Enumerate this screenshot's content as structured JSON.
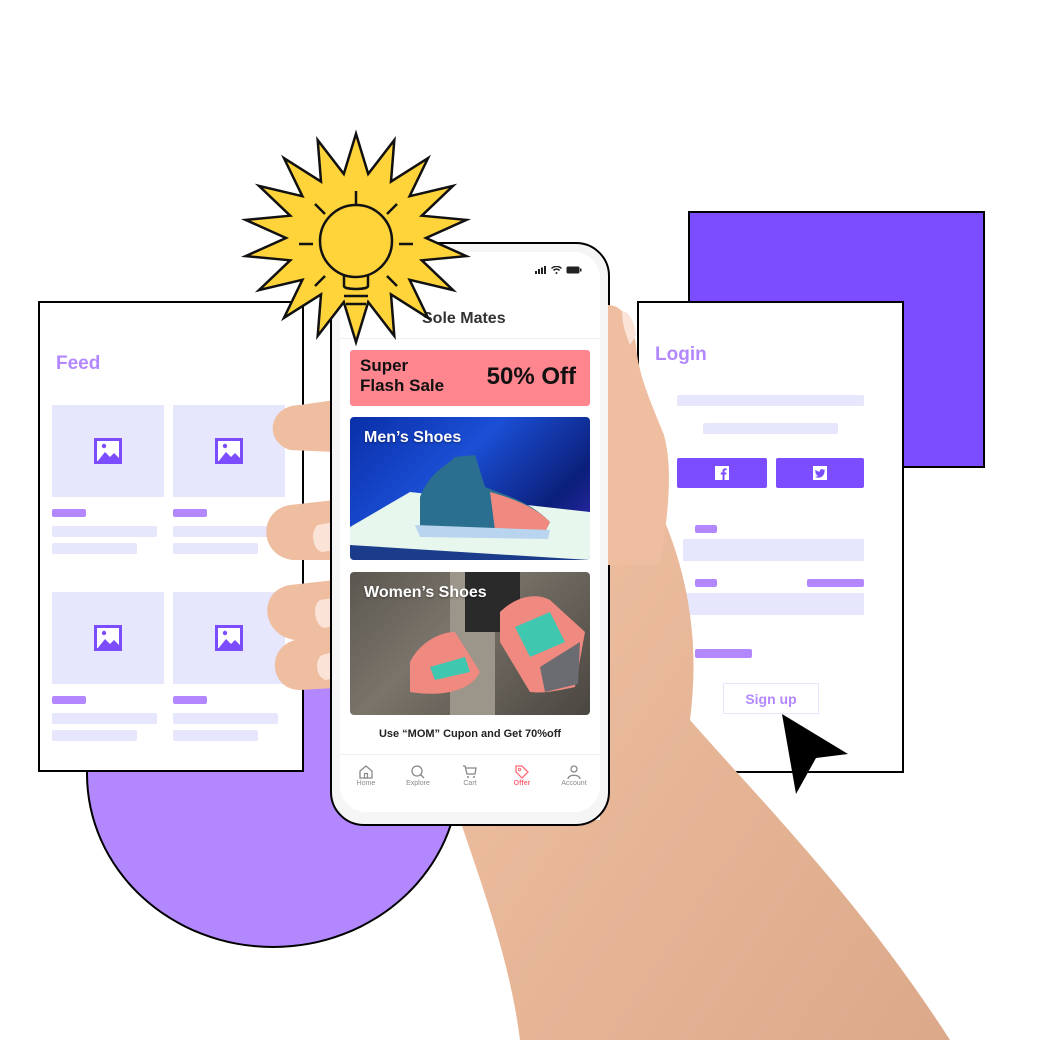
{
  "colors": {
    "accent_purple": "#7b4dff",
    "light_purple": "#b388ff",
    "placeholder": "#e6e6fd",
    "sale_pink": "#ff858f",
    "offer_active": "#ff6b7a",
    "burst_yellow": "#ffd43b"
  },
  "feed_card": {
    "title": "Feed",
    "icon": "image-placeholder-icon",
    "items": 4
  },
  "login_card": {
    "title": "Login",
    "social_buttons": [
      {
        "icon": "facebook-icon"
      },
      {
        "icon": "twitter-icon"
      }
    ],
    "signup_label": "Sign up"
  },
  "phone": {
    "status_icons": [
      "signal-icon",
      "wifi-icon",
      "battery-icon"
    ],
    "app_title": "Sole Mates",
    "banner": {
      "line1": "Super",
      "line2": "Flash Sale",
      "discount": "50% Off"
    },
    "categories": [
      {
        "label": "Men’s Shoes"
      },
      {
        "label": "Women’s Shoes"
      }
    ],
    "coupon_text": "Use “MOM” Cupon and Get 70%off",
    "nav": [
      {
        "label": "Home",
        "icon": "home-icon",
        "active": false
      },
      {
        "label": "Explore",
        "icon": "search-icon",
        "active": false
      },
      {
        "label": "Cart",
        "icon": "cart-icon",
        "active": false
      },
      {
        "label": "Offer",
        "icon": "tag-icon",
        "active": true
      },
      {
        "label": "Account",
        "icon": "user-icon",
        "active": false
      }
    ]
  },
  "decorations": {
    "burst_icon": "lightbulb-icon",
    "pointer_icon": "cursor-arrow-icon"
  }
}
